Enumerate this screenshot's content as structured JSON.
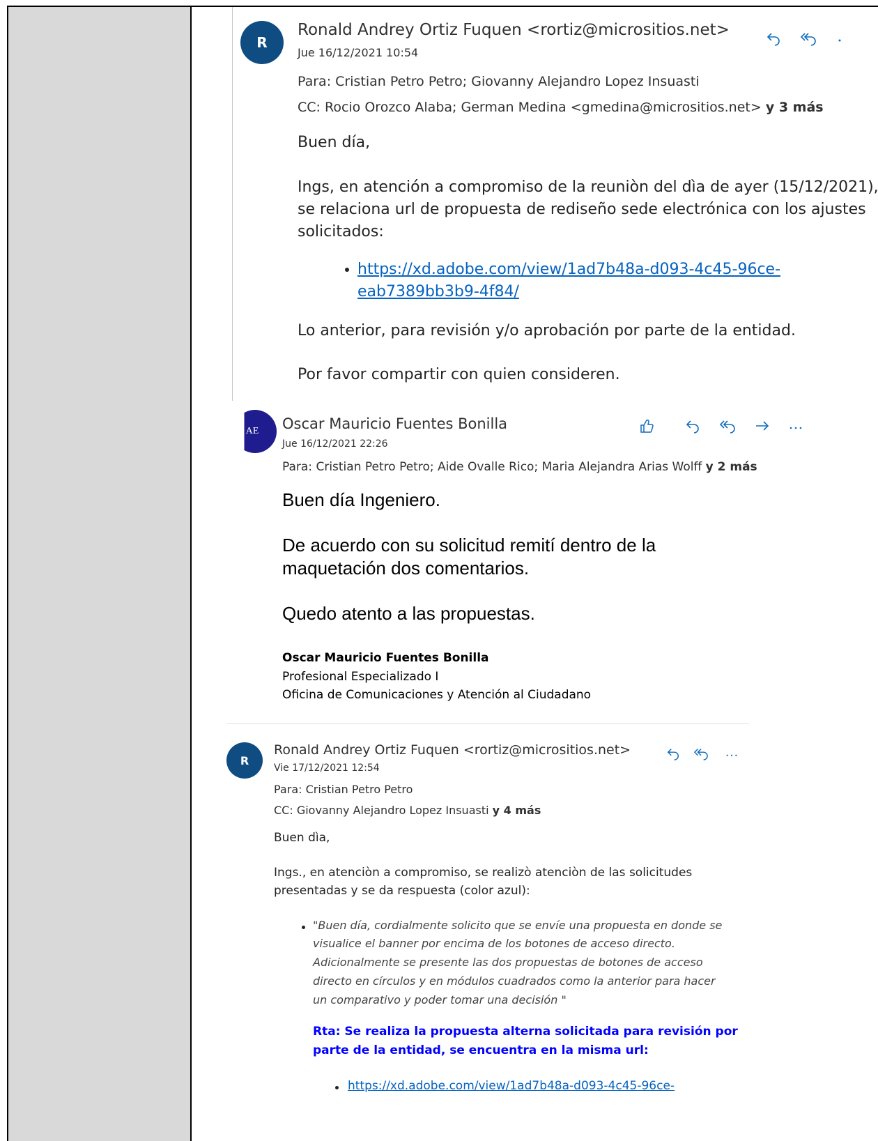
{
  "email1": {
    "avatar_letter": "R",
    "avatar_color": "#0f4c81",
    "sender": "Ronald Andrey Ortiz Fuquen <rortiz@micrositios.net>",
    "date": "Jue 16/12/2021 10:54",
    "to_label": "Para:",
    "to": "Cristian Petro Petro; Giovanny Alejandro Lopez Insuasti",
    "cc_label": "CC:",
    "cc": "Rocio Orozco Alaba; German Medina <gmedina@micrositios.net>",
    "cc_more": "y 3 más",
    "greeting": "Buen día,",
    "para1_line1": "Ings, en atención a compromiso de la reuniòn del dìa de ayer (15/12/2021),",
    "para1_line2": "se relaciona url de propuesta de rediseño sede electrónica con los ajustes",
    "para1_line3": "solicitados:",
    "link_line1": "https://xd.adobe.com/view/1ad7b48a-d093-4c45-96ce-",
    "link_line2": "eab7389bb3b9-4f84/",
    "para2": "Lo anterior,  para revisión y/o aprobación por parte de la entidad.",
    "para3": "Por favor compartir con quien consideren.",
    "actions": {
      "reply": "reply-icon",
      "reply_all": "reply-all-icon",
      "more": "more-icon"
    }
  },
  "email2": {
    "avatar_text": "AE",
    "avatar_color": "#1f1c8f",
    "sender": "Oscar Mauricio Fuentes Bonilla",
    "date": "Jue 16/12/2021 22:26",
    "to_label": "Para:",
    "to": "Cristian Petro Petro; Aide Ovalle Rico; Maria Alejandra Arias Wolff",
    "to_more": "y 2 más",
    "line1": "Buen día Ingeniero.",
    "line2a": "De acuerdo con su solicitud remití dentro de la",
    "line2b": "maquetación dos comentarios.",
    "line3": "Quedo atento a las propuestas.",
    "sig_name": "Oscar Mauricio Fuentes Bonilla",
    "sig_title": "Profesional Especializado I",
    "sig_office": "Oficina de Comunicaciones y Atención al Ciudadano",
    "actions": {
      "like": "like-icon",
      "reply": "reply-icon",
      "reply_all": "reply-all-icon",
      "forward": "forward-icon",
      "more": "more-icon"
    }
  },
  "email3": {
    "avatar_letter": "R",
    "avatar_color": "#0f4c81",
    "sender": "Ronald Andrey Ortiz Fuquen <rortiz@micrositios.net>",
    "date": "Vie 17/12/2021 12:54",
    "to_label": "Para:",
    "to": "Cristian Petro Petro",
    "cc_label": "CC:",
    "cc": "Giovanny Alejandro Lopez Insuasti",
    "cc_more": "y 4 más",
    "greeting": "Buen dìa,",
    "para1_line1": "Ings., en atenciòn a compromiso, se realizò atenciòn de las solicitudes",
    "para1_line2": "presentadas y se da respuesta (color azul):",
    "quote_lines": [
      "\"Buen día, cordialmente solicito que se envíe una propuesta en donde se",
      "visualice el banner por encima de los botones de acceso directo.",
      "Adicionalmente se presente las dos propuestas de botones de acceso",
      "directo en círculos y en módulos cuadrados como la anterior para hacer",
      "un comparativo y poder tomar una decisión \""
    ],
    "answer_line1": "Rta: Se realiza la propuesta alterna solicitada para revisión por",
    "answer_line2": "parte de la entidad, se encuentra en la misma url:",
    "answer_color": "#0000ff",
    "link": "https://xd.adobe.com/view/1ad7b48a-d093-4c45-96ce-",
    "actions": {
      "reply": "reply-icon",
      "reply_all": "reply-all-icon",
      "more": "more-icon"
    }
  }
}
